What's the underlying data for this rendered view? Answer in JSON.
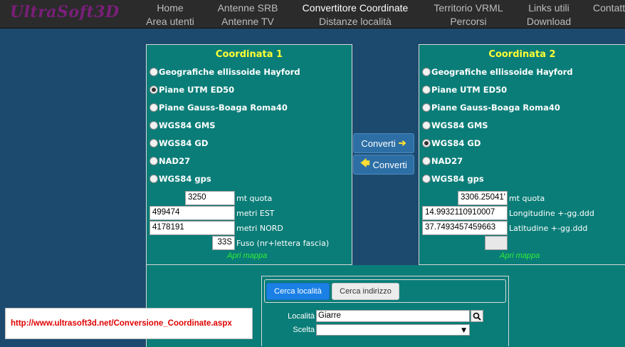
{
  "app": {
    "logo": "UltraSoft3D"
  },
  "nav": {
    "items": [
      {
        "label": "Home"
      },
      {
        "label": "Area utenti"
      },
      {
        "label": "Antenne SRB"
      },
      {
        "label": "Antenne TV"
      },
      {
        "label": "Convertitore Coordinate"
      },
      {
        "label": "Distanze località"
      },
      {
        "label": "Territorio VRML"
      },
      {
        "label": "Percorsi"
      },
      {
        "label": "Links utili"
      },
      {
        "label": "Download"
      },
      {
        "label": "Contatti"
      }
    ],
    "active": "Convertitore Coordinate"
  },
  "coord1": {
    "title": "Coordinata 1",
    "options": [
      {
        "label": "Geografiche ellissoide Hayford",
        "checked": false
      },
      {
        "label": "Piane UTM ED50",
        "checked": true
      },
      {
        "label": "Piane Gauss-Boaga Roma40",
        "checked": false
      },
      {
        "label": "WGS84 GMS",
        "checked": false
      },
      {
        "label": "WGS84 GD",
        "checked": false
      },
      {
        "label": "NAD27",
        "checked": false
      },
      {
        "label": "WGS84 gps",
        "checked": false
      }
    ],
    "fields": {
      "quota": {
        "value": "3250",
        "label": "mt quota"
      },
      "est": {
        "value": "499474",
        "label": "metri EST"
      },
      "nord": {
        "value": "4178191",
        "label": "metri NORD"
      },
      "fuso": {
        "value": "33S",
        "label": "Fuso (nr+lettera fascia)"
      }
    },
    "map_link": "Apri mappa"
  },
  "coord2": {
    "title": "Coordinata 2",
    "options": [
      {
        "label": "Geografiche ellissoide Hayford",
        "checked": false
      },
      {
        "label": "Piane UTM ED50",
        "checked": false
      },
      {
        "label": "Piane Gauss-Boaga Roma40",
        "checked": false
      },
      {
        "label": "WGS84 GMS",
        "checked": false
      },
      {
        "label": "WGS84 GD",
        "checked": true
      },
      {
        "label": "NAD27",
        "checked": false
      },
      {
        "label": "WGS84 gps",
        "checked": false
      }
    ],
    "fields": {
      "quota": {
        "value": "3306.25041'",
        "label": "mt quota"
      },
      "lon": {
        "value": "14.9932110910007",
        "label": "Longitudine +-gg.ddd"
      },
      "lat": {
        "value": "37.7493457459663",
        "label": "Latitudine +-gg.ddd"
      },
      "extra": {
        "value": ""
      }
    },
    "map_link": "Apri mappa"
  },
  "convert": {
    "forward_label": "Converti",
    "backward_label": "Converti"
  },
  "url_banner": "http://www.ultrasoft3d.net/Conversione_Coordinate.aspx",
  "search": {
    "tabs": [
      {
        "label": "Cerca località",
        "active": true
      },
      {
        "label": "Cerca indirizzo",
        "active": false
      }
    ],
    "localita_label": "Località",
    "localita_value": "Giarre",
    "scelta_label": "Scelta",
    "scelta_value": ""
  },
  "colors": {
    "page_bg": "#1c4a6e",
    "nav_bg": "#2b2b2b",
    "panel_bg": "#0a7d78",
    "title_yellow": "#ffff33",
    "link_green": "#33ee33",
    "button_blue": "#2d6fa5",
    "tab_active": "#1a80e6",
    "url_red": "#e00000"
  }
}
